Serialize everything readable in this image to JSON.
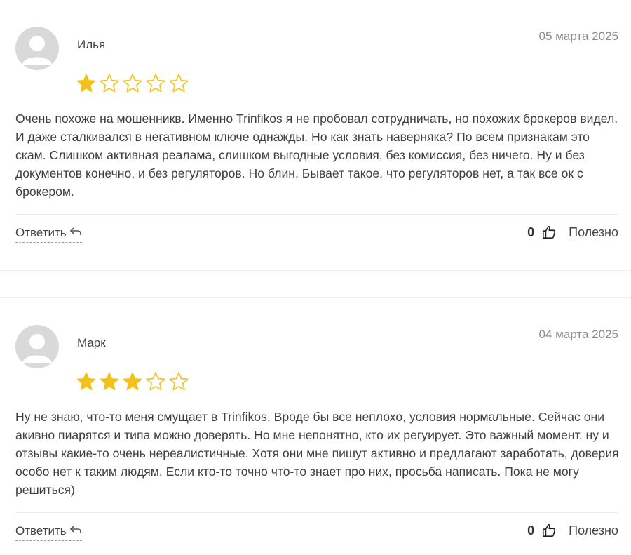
{
  "colors": {
    "star_filled": "#f2c21a",
    "star_empty_stroke": "#f2c21a",
    "avatar_bg": "#d9d9d9",
    "text": "#3f3f3f",
    "date": "#8c8c8c"
  },
  "reviews": [
    {
      "author": "Илья",
      "date": "05 марта 2025",
      "rating": 1,
      "rating_max": 5,
      "text": "Очень похоже на мошенникв. Именно Trinfikos я не пробовал сотрудничать, но похожих брокеров видел. И даже сталкивался в негативном ключе однажды. Но как знать наверняка? По всем признакам это скам. Слишком активная реалама, слишком выгодные условия, без комиссия, без ничего. Ну и без документов конечно, и без регуляторов. Но блин. Бывает такое, что регуляторов нет, а так все ок с брокером.",
      "reply_label": "Ответить",
      "votes": "0",
      "helpful_label": "Полезно",
      "icons": {
        "avatar": "user-avatar-icon",
        "reply": "reply-arrow-icon",
        "thumb": "thumbs-up-icon"
      }
    },
    {
      "author": "Марк",
      "date": "04 марта 2025",
      "rating": 3,
      "rating_max": 5,
      "text": "Ну не знаю, что-то меня смущает в Trinfikos. Вроде бы все неплохо, условия нормальные. Сейчас они акивно пиарятся и типа можно доверять. Но мне непонятно, кто их регуирует. Это важный момент. ну и отзывы какие-то очень нереалистичные. Хотя они мне пишут активно и предлагают заработать, доверия особо нет к таким людям. Если кто-то точно что-то знает про них, просьба написать. Пока не могу решиться)",
      "reply_label": "Ответить",
      "votes": "0",
      "helpful_label": "Полезно",
      "icons": {
        "avatar": "user-avatar-icon",
        "reply": "reply-arrow-icon",
        "thumb": "thumbs-up-icon"
      }
    }
  ]
}
